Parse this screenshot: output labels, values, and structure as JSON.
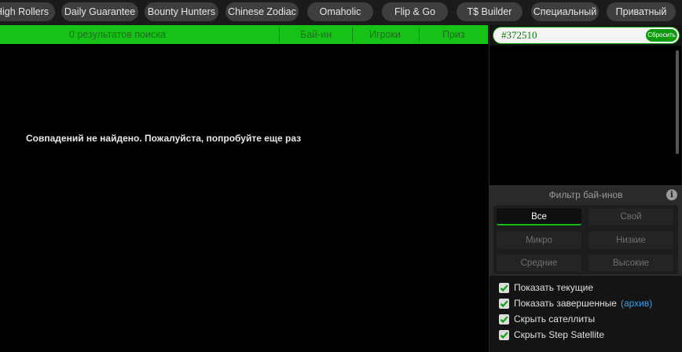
{
  "tabs": [
    {
      "label": "High Rollers"
    },
    {
      "label": "Daily Guarantee"
    },
    {
      "label": "Bounty Hunters"
    },
    {
      "label": "Chinese Zodiac"
    },
    {
      "label": "Omaholic"
    },
    {
      "label": "Flip & Go"
    },
    {
      "label": "T$ Builder"
    },
    {
      "label": "Специальный"
    },
    {
      "label": "Приватный"
    }
  ],
  "results_header": {
    "count_text": "0 результатов поиска",
    "col_buyin": "Бай-ин",
    "col_players": "Игроки",
    "col_prize": "Приз"
  },
  "no_results_message": "Совпадений не найдено. Пожалуйста, попробуйте еще раз",
  "search": {
    "value": "#372510",
    "reset_label": "Сбросить"
  },
  "buyin_filter": {
    "title": "Фильтр бай-инов",
    "buttons": [
      {
        "label": "Все",
        "active": true
      },
      {
        "label": "Свой",
        "active": false
      },
      {
        "label": "Микро",
        "active": false
      },
      {
        "label": "Низкие",
        "active": false
      },
      {
        "label": "Средние",
        "active": false
      },
      {
        "label": "Высокие",
        "active": false
      }
    ]
  },
  "options": {
    "show_current": {
      "label": "Показать текущие",
      "checked": true
    },
    "show_finished": {
      "label": "Показать завершенные",
      "link": "(архив)",
      "checked": true
    },
    "hide_satellites": {
      "label": "Скрыть сателлиты",
      "checked": true
    },
    "hide_step_satellite": {
      "label": "Скрыть Step Satellite",
      "checked": true
    }
  },
  "colors": {
    "accent_green": "#17c217",
    "link_blue": "#3aa0e8"
  }
}
